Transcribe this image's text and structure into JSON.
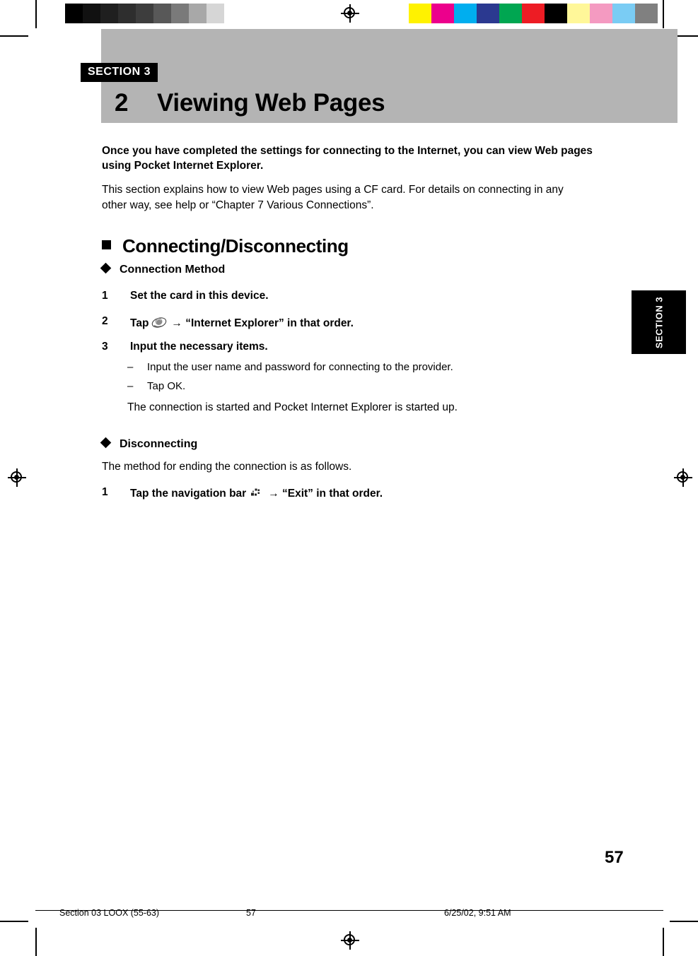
{
  "header": {
    "section_tag": "SECTION 3",
    "chapter_number": "2",
    "chapter_title": "Viewing Web Pages"
  },
  "side_tab": {
    "label": "SECTION 3"
  },
  "body": {
    "lead": "Once you have completed the settings for connecting to the Internet, you can view Web pages using Pocket Internet Explorer.",
    "intro": "This section explains how to view Web pages using a CF card. For details on connecting in any other way, see help or “Chapter 7 Various Connections”.",
    "heading_connecting": "Connecting/Disconnecting",
    "subheading_connection_method": "Connection Method",
    "steps": [
      {
        "num": "1",
        "text": "Set the card in this device."
      },
      {
        "num": "2",
        "text_before": "Tap",
        "icon": "internet-explorer-icon",
        "text_after": "→ “Internet Explorer” in that order."
      },
      {
        "num": "3",
        "text": "Input the necessary items."
      }
    ],
    "substeps": [
      {
        "dash": "–",
        "text": "Input the user name and password for connecting to the provider."
      },
      {
        "dash": "–",
        "text": "Tap OK."
      }
    ],
    "after_steps": "The connection is started and Pocket Internet Explorer is started up.",
    "subheading_disconnecting": "Disconnecting",
    "disconnecting_intro": "The method for ending the connection is as follows.",
    "disconnect_step": {
      "num": "1",
      "text_before": "Tap the navigation bar",
      "icon": "navigation-bar-icon",
      "text_after": "→ “Exit” in that order."
    },
    "page_number": "57"
  },
  "footer": {
    "left": "Section 03 LOOX (55-63)",
    "middle": "57",
    "right": "6/25/02, 9:51 AM"
  },
  "calibration": {
    "left_swatches": [
      "#000000",
      "#111111",
      "#1f1f1f",
      "#2e2e2e",
      "#3d3d3d",
      "#585858",
      "#7a7a7a",
      "#a8a8a8",
      "#d6d6d6",
      "#ffffff"
    ],
    "right_swatches": [
      "#fff200",
      "#ec008c",
      "#00aeef",
      "#2b3990",
      "#00a651",
      "#ed1c24",
      "#000000",
      "#fff799",
      "#f49ac1",
      "#7accf4",
      "#808080"
    ]
  },
  "colors": {
    "header_band": "#b4b4b4",
    "tag_background": "#000000",
    "tag_text": "#ffffff"
  }
}
